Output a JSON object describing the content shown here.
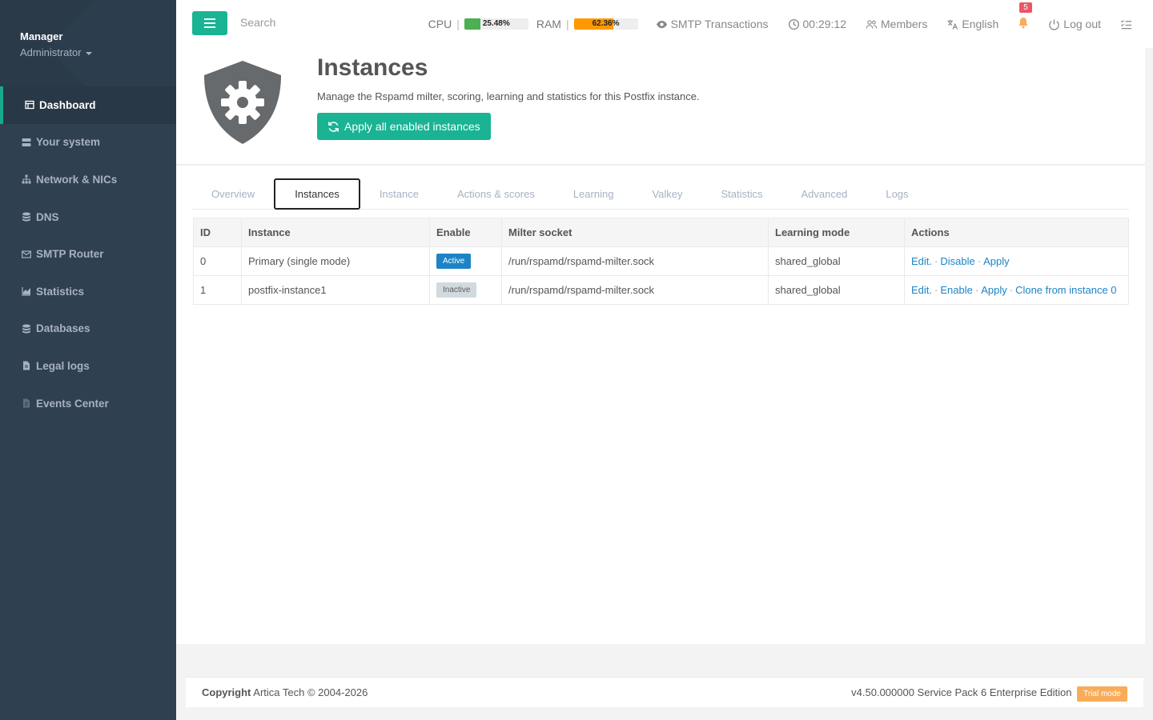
{
  "profile": {
    "name": "Manager",
    "role": "Administrator"
  },
  "sidebar": {
    "items": [
      {
        "label": "Dashboard",
        "icon": "table-icon"
      },
      {
        "label": "Your system",
        "icon": "server-icon"
      },
      {
        "label": "Network & NICs",
        "icon": "sitemap-icon"
      },
      {
        "label": "DNS",
        "icon": "database-icon"
      },
      {
        "label": "SMTP Router",
        "icon": "envelope-icon"
      },
      {
        "label": "Statistics",
        "icon": "area-chart-icon"
      },
      {
        "label": "Databases",
        "icon": "database-icon"
      },
      {
        "label": "Legal logs",
        "icon": "file-icon"
      },
      {
        "label": "Events Center",
        "icon": "file-text-icon"
      }
    ]
  },
  "topbar": {
    "search_placeholder": "Search",
    "cpu": {
      "label": "CPU",
      "value": "25.48%",
      "fill": 0.2548,
      "color": "#4caf50"
    },
    "ram": {
      "label": "RAM",
      "value": "62.36%",
      "fill": 0.6236,
      "color": "#ff9800"
    },
    "smtp_transactions": "SMTP Transactions",
    "clock": "00:29:12",
    "members": "Members",
    "language": "English",
    "notifications_count": "5",
    "logout": "Log out"
  },
  "header": {
    "title": "Instances",
    "description": "Manage the Rspamd milter, scoring, learning and statistics for this Postfix instance.",
    "apply_button": "Apply all enabled instances"
  },
  "tabs": [
    "Overview",
    "Instances",
    "Instance",
    "Actions & scores",
    "Learning",
    "Valkey",
    "Statistics",
    "Advanced",
    "Logs"
  ],
  "table": {
    "headers": [
      "ID",
      "Instance",
      "Enable",
      "Milter socket",
      "Learning mode",
      "Actions"
    ],
    "rows": [
      {
        "id": "0",
        "instance": "Primary (single mode)",
        "enable": "Active",
        "socket": "/run/rspamd/rspamd-milter.sock",
        "mode": "shared_global",
        "actions": [
          "Edit.",
          "Disable",
          "Apply"
        ]
      },
      {
        "id": "1",
        "instance": "postfix-instance1",
        "enable": "Inactive",
        "socket": "/run/rspamd/rspamd-milter.sock",
        "mode": "shared_global",
        "actions": [
          "Edit.",
          "Enable",
          "Apply",
          "Clone from instance 0"
        ]
      }
    ]
  },
  "footer": {
    "copyright_bold": "Copyright",
    "copyright_text": "Artica Tech © 2004-2026",
    "version": "v4.50.000000 Service Pack 6 Enterprise Edition",
    "trial": "Trial mode"
  }
}
